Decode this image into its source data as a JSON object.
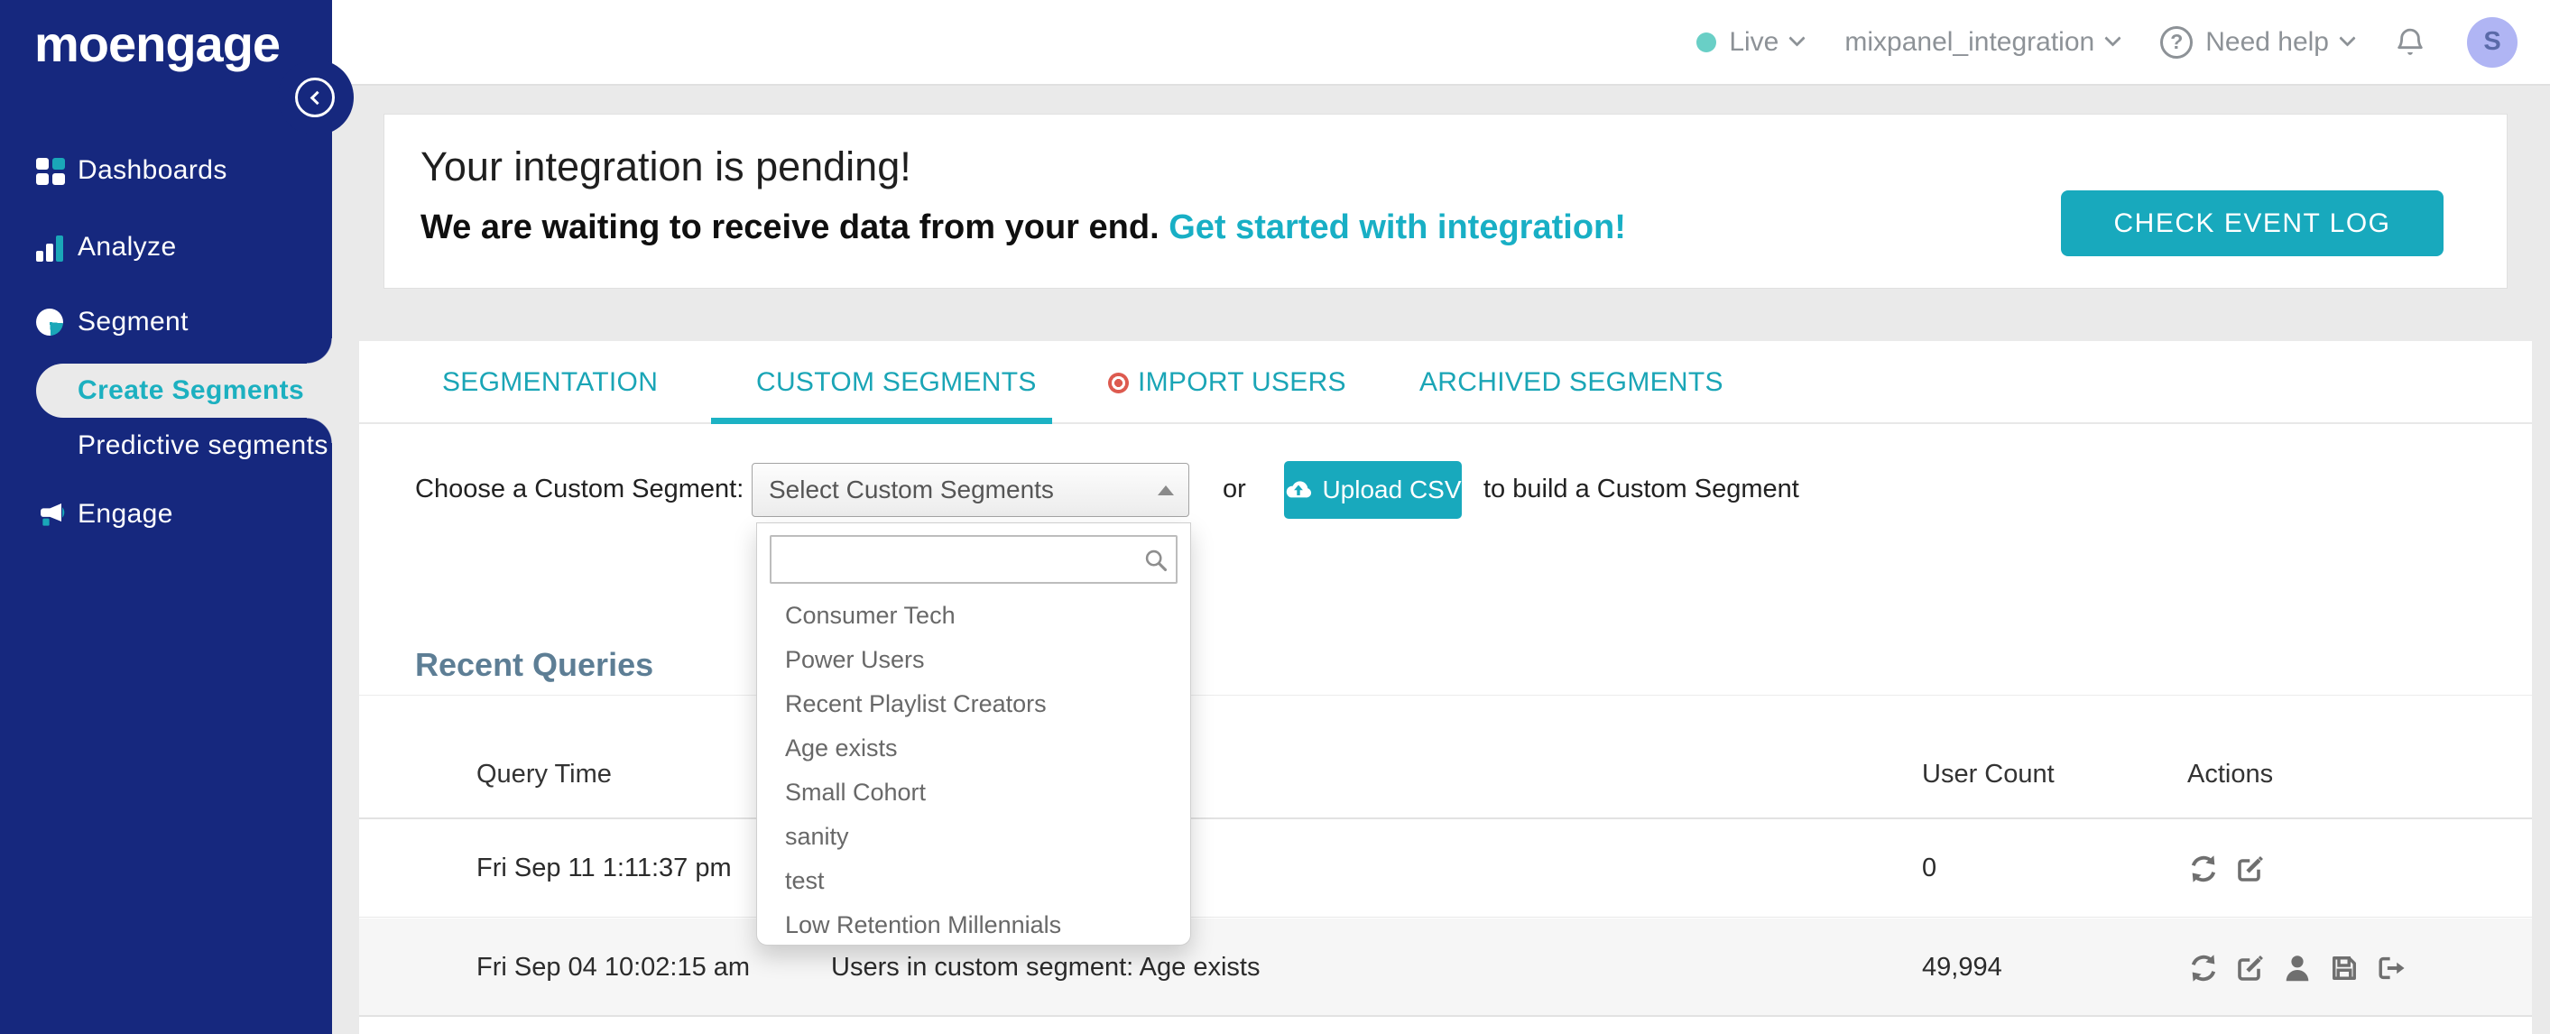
{
  "colors": {
    "sidebar_navy": "#16287E",
    "accent_teal": "#18A9BD",
    "tab_teal": "#1AA5B6",
    "active_item_teal": "#1CB0C0",
    "link_teal": "#18AFC5",
    "live_dot": "#69CFC6",
    "avatar_bg": "#B0B5F4",
    "import_users_icon": "#DD5A4F",
    "section_heading": "#5D7E95",
    "page_bg": "#EAEAEA"
  },
  "sidebar": {
    "logo_text": "moengage",
    "items": [
      {
        "label": "Dashboards"
      },
      {
        "label": "Analyze"
      },
      {
        "label": "Segment"
      },
      {
        "label": "Create Segments"
      },
      {
        "label": "Predictive segments"
      },
      {
        "label": "Engage"
      }
    ],
    "active_item": "Create Segments"
  },
  "header": {
    "env_label": "Live",
    "workspace_label": "mixpanel_integration",
    "help_glyph": "?",
    "help_label": "Need help",
    "avatar_initial": "S"
  },
  "banner": {
    "title": "Your integration is pending!",
    "subtitle": "We are waiting to receive data from your end.",
    "link_label": "Get started with integration!",
    "button_label": "CHECK EVENT LOG"
  },
  "tabs": {
    "items": [
      {
        "label": "SEGMENTATION"
      },
      {
        "label": "CUSTOM SEGMENTS"
      },
      {
        "label": "IMPORT USERS"
      },
      {
        "label": "ARCHIVED SEGMENTS"
      }
    ],
    "active": "CUSTOM SEGMENTS"
  },
  "picker": {
    "label": "Choose a Custom Segment:",
    "select_value": "Select Custom Segments",
    "or_text": "or",
    "upload_label": "Upload CSV",
    "suffix_text": "to build a Custom Segment",
    "search_value": "",
    "options": [
      "Consumer Tech",
      "Power Users",
      "Recent Playlist Creators",
      "Age exists",
      "Small Cohort",
      "sanity",
      "test",
      "Low Retention Millennials"
    ]
  },
  "recent": {
    "title": "Recent Queries",
    "col_query_time": "Query Time",
    "col_user_count": "User Count",
    "col_actions": "Actions",
    "rows": [
      {
        "time": "Fri Sep 11 1:11:37 pm",
        "query": "",
        "count": "0"
      },
      {
        "time": "Fri Sep 04 10:02:15 am",
        "query": "Users in custom segment: Age exists",
        "count": "49,994"
      }
    ]
  }
}
